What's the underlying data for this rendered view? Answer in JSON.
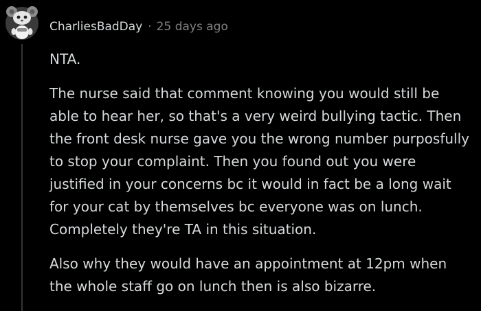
{
  "comment": {
    "author": "CharliesBadDay",
    "separator": "·",
    "timestamp": "25 days ago",
    "avatar_icon": "snoo-avatar-icon",
    "paragraphs": [
      "NTA.",
      "The nurse said that comment knowing you would still be able to hear her, so that's a very weird bullying tactic. Then the front desk nurse gave you the wrong number purposfully to stop your complaint. Then you found out you were justified in your concerns bc it would in fact be a long wait for your cat by themselves bc everyone was on lunch. Completely they're TA in this situation.",
      "Also why they would have an appointment at 12pm when the whole staff go on lunch then is also bizarre."
    ]
  },
  "colors": {
    "background": "#000000",
    "text": "#d7dadc",
    "meta": "#818384",
    "thread_line": "#343536"
  }
}
